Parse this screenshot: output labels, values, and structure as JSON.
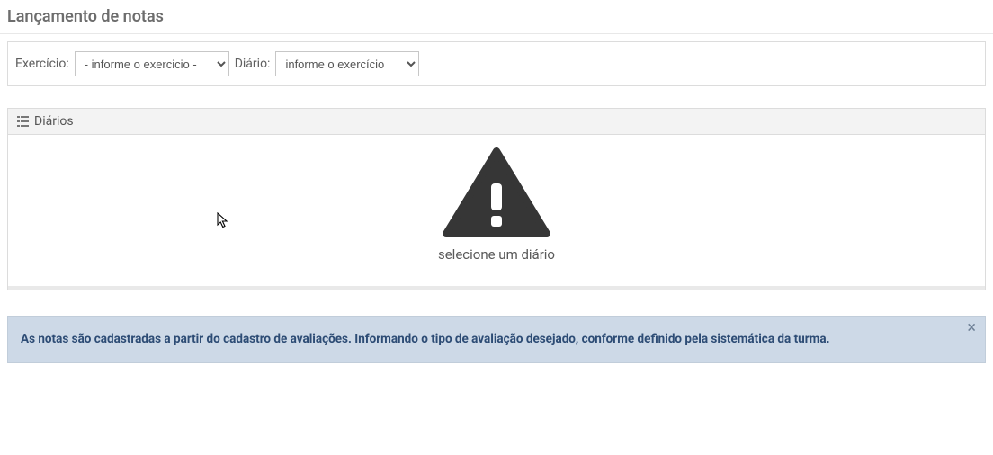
{
  "page": {
    "title": "Lançamento de notas"
  },
  "filters": {
    "exercicio_label": "Exercício:",
    "exercicio_placeholder": "- informe o exercicio -",
    "diario_label": "Diário:",
    "diario_placeholder": "informe o exercício"
  },
  "panel": {
    "header_title": "Diários",
    "empty_message": "selecione um diário"
  },
  "alert": {
    "text": "As notas são cadastradas a partir do cadastro de avaliações. Informando o tipo de avaliação desejado, conforme definido pela sistemática da turma.",
    "close": "×"
  }
}
